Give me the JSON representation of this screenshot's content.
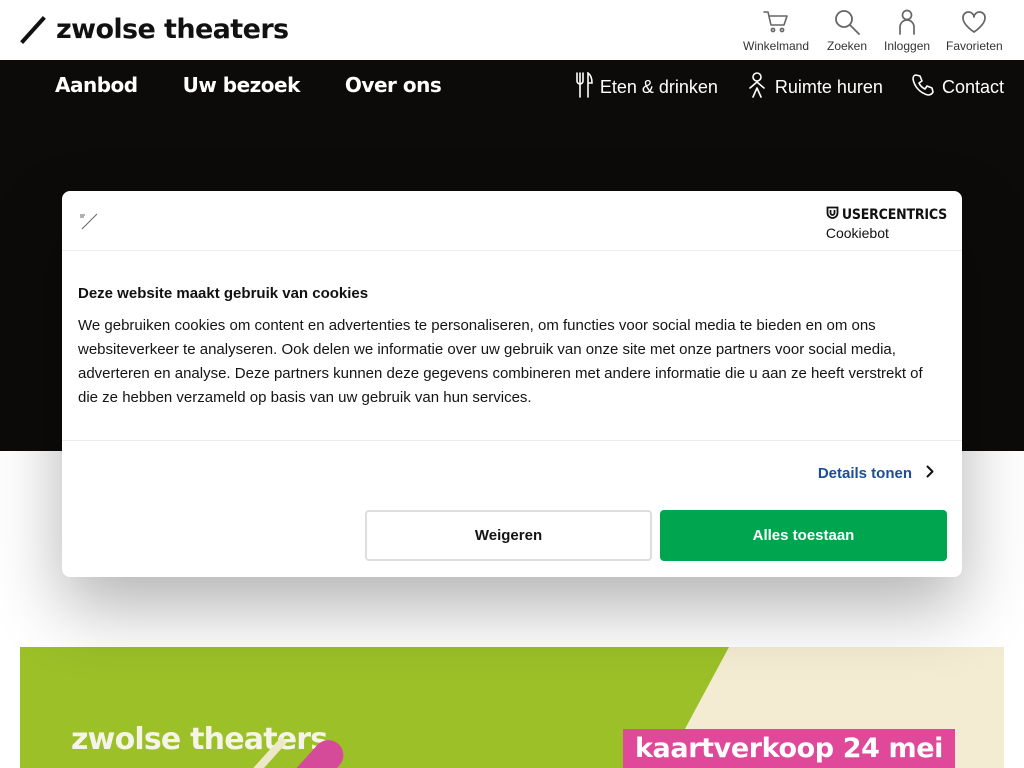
{
  "header": {
    "logo_text": "zwolse theaters",
    "utility": [
      {
        "label": "Winkelmand",
        "icon": "cart-icon"
      },
      {
        "label": "Zoeken",
        "icon": "search-icon"
      },
      {
        "label": "Inloggen",
        "icon": "user-icon"
      },
      {
        "label": "Favorieten",
        "icon": "heart-icon"
      }
    ]
  },
  "nav": {
    "main": [
      "Aanbod",
      "Uw bezoek",
      "Over ons"
    ],
    "secondary": [
      {
        "label": "Eten & drinken",
        "icon": "cutlery-icon"
      },
      {
        "label": "Ruimte huren",
        "icon": "person-icon"
      },
      {
        "label": "Contact",
        "icon": "phone-icon"
      }
    ]
  },
  "cookie_dialog": {
    "brand_top": "USERCENTRICS",
    "brand_sub": "Cookiebot",
    "title": "Deze website maakt gebruik van cookies",
    "body": "We gebruiken cookies om content en advertenties te personaliseren, om functies voor social media te bieden en om ons websiteverkeer te analyseren. Ook delen we informatie over uw gebruik van onze site met onze partners voor social media, adverteren en analyse. Deze partners kunnen deze gegevens combineren met andere informatie die u aan ze heeft verstrekt of die ze hebben verzameld op basis van uw gebruik van hun services.",
    "details_label": "Details tonen",
    "deny_label": "Weigeren",
    "allow_label": "Alles toestaan"
  },
  "banner": {
    "brand": "zwolse theaters",
    "sale_text": "kaartverkoop 24 mei"
  },
  "colors": {
    "nav_bg": "#0d0b09",
    "allow_green": "#00a64f",
    "link_blue": "#1a4f96",
    "banner_green": "#9bc028",
    "banner_pink": "#e0489a"
  }
}
